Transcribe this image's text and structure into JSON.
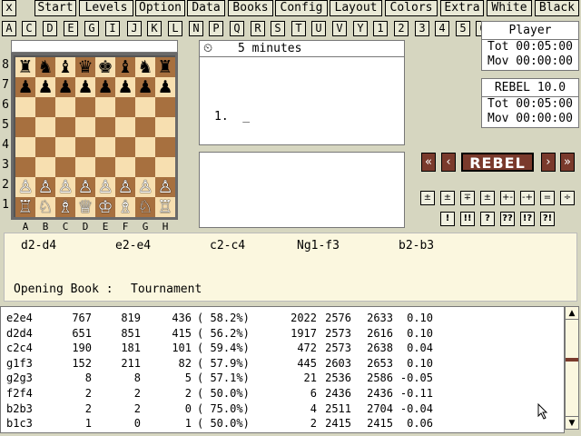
{
  "menu": {
    "close": "x",
    "items": [
      "Start",
      "Levels",
      "Option",
      "Data",
      "Books",
      "Config",
      "Layout",
      "Colors",
      "Extra",
      "White",
      "Black"
    ]
  },
  "keys": [
    "A",
    "C",
    "D",
    "E",
    "G",
    "I",
    "J",
    "K",
    "L",
    "N",
    "P",
    "Q",
    "R",
    "S",
    "T",
    "U",
    "V",
    "Y",
    "1",
    "2",
    "3",
    "4",
    "5",
    "6"
  ],
  "board": {
    "ranks": [
      "8",
      "7",
      "6",
      "5",
      "4",
      "3",
      "2",
      "1"
    ],
    "files": [
      "A",
      "B",
      "C",
      "D",
      "E",
      "F",
      "G",
      "H"
    ],
    "pieces": [
      [
        "♜",
        "♞",
        "♝",
        "♛",
        "♚",
        "♝",
        "♞",
        "♜"
      ],
      [
        "♟",
        "♟",
        "♟",
        "♟",
        "♟",
        "♟",
        "♟",
        "♟"
      ],
      [
        "",
        "",
        "",
        "",
        "",
        "",
        "",
        ""
      ],
      [
        "",
        "",
        "",
        "",
        "",
        "",
        "",
        ""
      ],
      [
        "",
        "",
        "",
        "",
        "",
        "",
        "",
        ""
      ],
      [
        "",
        "",
        "",
        "",
        "",
        "",
        "",
        ""
      ],
      [
        "♙",
        "♙",
        "♙",
        "♙",
        "♙",
        "♙",
        "♙",
        "♙"
      ],
      [
        "♖",
        "♘",
        "♗",
        "♕",
        "♔",
        "♗",
        "♘",
        "♖"
      ]
    ]
  },
  "notation": {
    "level": "5 minutes",
    "move_line": "1.  _"
  },
  "clocks": {
    "player": {
      "title": "Player",
      "tot": "Tot 00:05:00",
      "mov": "Mov 00:00:00"
    },
    "engine": {
      "title": "REBEL 10.0",
      "tot": "Tot 00:05:00",
      "mov": "Mov 00:00:00"
    }
  },
  "nav": {
    "first": "«",
    "prev": "‹",
    "logo": "REBEL",
    "next": "›",
    "last": "»"
  },
  "eval_buttons": {
    "row1": [
      "±",
      "±",
      "∓",
      "±",
      "+-",
      "-+",
      "=",
      "÷"
    ],
    "row2": [
      "!",
      "!!",
      "?",
      "??",
      "!?",
      "?!"
    ]
  },
  "book": {
    "moves": [
      "d2-d4",
      "e2-e4",
      "c2-c4",
      "Ng1-f3",
      "b2-b3"
    ],
    "label": "Opening Book :",
    "name": "Tournament"
  },
  "stats": [
    [
      "e2e4",
      "767",
      "819",
      "436",
      "( 58.2%)",
      "2022",
      "2576",
      "2633",
      "0.10"
    ],
    [
      "d2d4",
      "651",
      "851",
      "415",
      "( 56.2%)",
      "1917",
      "2573",
      "2616",
      "0.10"
    ],
    [
      "c2c4",
      "190",
      "181",
      "101",
      "( 59.4%)",
      "472",
      "2573",
      "2638",
      "0.04"
    ],
    [
      "g1f3",
      "152",
      "211",
      "82",
      "( 57.9%)",
      "445",
      "2603",
      "2653",
      "0.10"
    ],
    [
      "g2g3",
      "8",
      "8",
      "5",
      "( 57.1%)",
      "21",
      "2536",
      "2586",
      "-0.05"
    ],
    [
      "f2f4",
      "2",
      "2",
      "2",
      "( 50.0%)",
      "6",
      "2436",
      "2436",
      "-0.11"
    ],
    [
      "b2b3",
      "2",
      "2",
      "0",
      "( 75.0%)",
      "4",
      "2511",
      "2704",
      "-0.04"
    ],
    [
      "b1c3",
      "1",
      "0",
      "1",
      "( 50.0%)",
      "2",
      "2415",
      "2415",
      "0.06"
    ]
  ]
}
